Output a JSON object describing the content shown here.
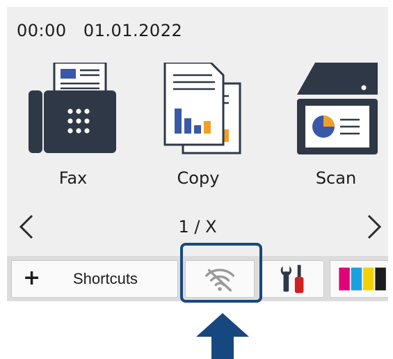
{
  "status": {
    "time": "00:00",
    "date": "01.01.2022"
  },
  "apps": [
    {
      "label": "Fax"
    },
    {
      "label": "Copy"
    },
    {
      "label": "Scan"
    }
  ],
  "pager": {
    "current": "1 / X"
  },
  "bottom_bar": {
    "shortcuts_icon": "+",
    "shortcuts_label": "Shortcuts",
    "wifi_icon": "wifi-off-icon",
    "settings_icon": "tools-icon",
    "ink_icon": "ink-cartridges-icon"
  },
  "colors": {
    "device_dark": "#2f3846",
    "accent_blue": "#3a58a8",
    "accent_orange": "#f0a028",
    "highlight_frame": "#17477f",
    "ink_cyan": "#1da0e0",
    "ink_magenta": "#e0007a",
    "ink_yellow": "#f2d200",
    "ink_black": "#1c1c1c"
  }
}
